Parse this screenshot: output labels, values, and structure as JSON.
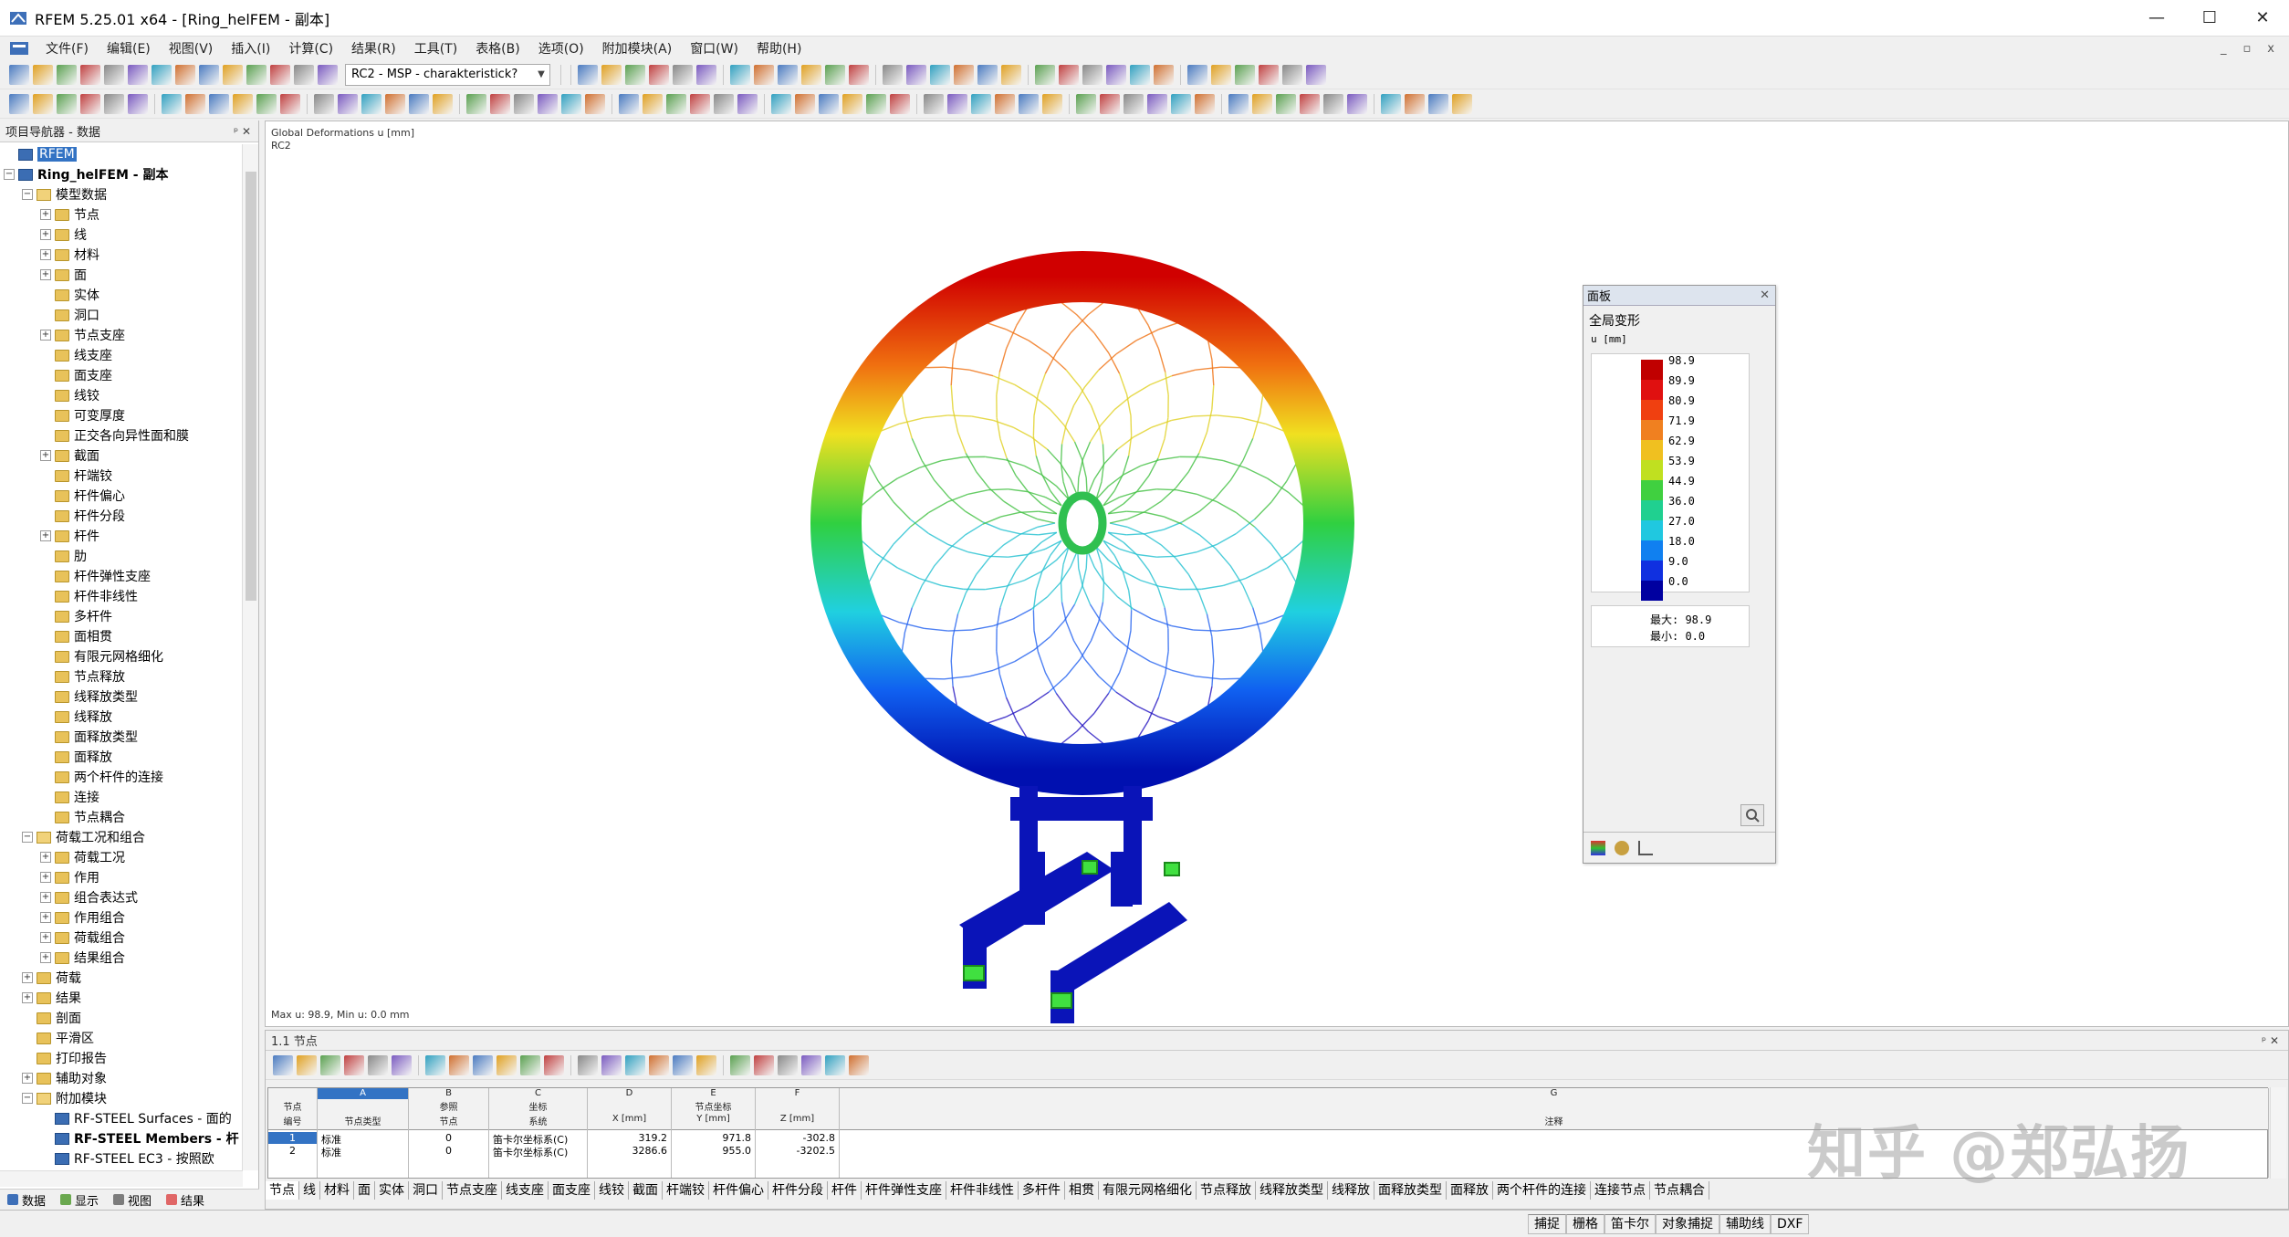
{
  "window": {
    "title": "RFEM 5.25.01 x64 - [Ring_helFEM - 副本]",
    "min": "—",
    "max": "☐",
    "close": "✕"
  },
  "menu": [
    "文件(F)",
    "编辑(E)",
    "视图(V)",
    "插入(I)",
    "计算(C)",
    "结果(R)",
    "工具(T)",
    "表格(B)",
    "选项(O)",
    "附加模块(A)",
    "窗口(W)",
    "帮助(H)"
  ],
  "mdi": {
    "min": "_",
    "restore": "▫",
    "close": "x"
  },
  "toolbar": {
    "combo_value": "RC2 - MSP - charakteristick?"
  },
  "navigator": {
    "title": "项目导航器 - 数据",
    "pin": "ᵖ ✕",
    "tree": [
      {
        "label": "RFEM",
        "level": 0,
        "exp": "",
        "icon": "app",
        "selected": true
      },
      {
        "label": "Ring_helFEM - 副本",
        "level": 0,
        "exp": "−",
        "icon": "doc",
        "bold": true
      },
      {
        "label": "模型数据",
        "level": 1,
        "exp": "−",
        "icon": "open"
      },
      {
        "label": "节点",
        "level": 2,
        "exp": "+",
        "icon": "folder"
      },
      {
        "label": "线",
        "level": 2,
        "exp": "+",
        "icon": "folder"
      },
      {
        "label": "材料",
        "level": 2,
        "exp": "+",
        "icon": "folder"
      },
      {
        "label": "面",
        "level": 2,
        "exp": "+",
        "icon": "folder"
      },
      {
        "label": "实体",
        "level": 2,
        "exp": "",
        "icon": "folder"
      },
      {
        "label": "洞口",
        "level": 2,
        "exp": "",
        "icon": "folder"
      },
      {
        "label": "节点支座",
        "level": 2,
        "exp": "+",
        "icon": "folder"
      },
      {
        "label": "线支座",
        "level": 2,
        "exp": "",
        "icon": "folder"
      },
      {
        "label": "面支座",
        "level": 2,
        "exp": "",
        "icon": "folder"
      },
      {
        "label": "线铰",
        "level": 2,
        "exp": "",
        "icon": "folder"
      },
      {
        "label": "可变厚度",
        "level": 2,
        "exp": "",
        "icon": "folder"
      },
      {
        "label": "正交各向异性面和膜",
        "level": 2,
        "exp": "",
        "icon": "folder"
      },
      {
        "label": "截面",
        "level": 2,
        "exp": "+",
        "icon": "folder"
      },
      {
        "label": "杆端铰",
        "level": 2,
        "exp": "",
        "icon": "folder"
      },
      {
        "label": "杆件偏心",
        "level": 2,
        "exp": "",
        "icon": "folder"
      },
      {
        "label": "杆件分段",
        "level": 2,
        "exp": "",
        "icon": "folder"
      },
      {
        "label": "杆件",
        "level": 2,
        "exp": "+",
        "icon": "folder"
      },
      {
        "label": "肋",
        "level": 2,
        "exp": "",
        "icon": "folder"
      },
      {
        "label": "杆件弹性支座",
        "level": 2,
        "exp": "",
        "icon": "folder"
      },
      {
        "label": "杆件非线性",
        "level": 2,
        "exp": "",
        "icon": "folder"
      },
      {
        "label": "多杆件",
        "level": 2,
        "exp": "",
        "icon": "folder"
      },
      {
        "label": "面相贯",
        "level": 2,
        "exp": "",
        "icon": "folder"
      },
      {
        "label": "有限元网格细化",
        "level": 2,
        "exp": "",
        "icon": "folder"
      },
      {
        "label": "节点释放",
        "level": 2,
        "exp": "",
        "icon": "folder"
      },
      {
        "label": "线释放类型",
        "level": 2,
        "exp": "",
        "icon": "folder"
      },
      {
        "label": "线释放",
        "level": 2,
        "exp": "",
        "icon": "folder"
      },
      {
        "label": "面释放类型",
        "level": 2,
        "exp": "",
        "icon": "folder"
      },
      {
        "label": "面释放",
        "level": 2,
        "exp": "",
        "icon": "folder"
      },
      {
        "label": "两个杆件的连接",
        "level": 2,
        "exp": "",
        "icon": "folder"
      },
      {
        "label": "连接",
        "level": 2,
        "exp": "",
        "icon": "folder"
      },
      {
        "label": "节点耦合",
        "level": 2,
        "exp": "",
        "icon": "folder"
      },
      {
        "label": "荷载工况和组合",
        "level": 1,
        "exp": "−",
        "icon": "open"
      },
      {
        "label": "荷载工况",
        "level": 2,
        "exp": "+",
        "icon": "folder"
      },
      {
        "label": "作用",
        "level": 2,
        "exp": "+",
        "icon": "folder"
      },
      {
        "label": "组合表达式",
        "level": 2,
        "exp": "+",
        "icon": "folder"
      },
      {
        "label": "作用组合",
        "level": 2,
        "exp": "+",
        "icon": "folder"
      },
      {
        "label": "荷载组合",
        "level": 2,
        "exp": "+",
        "icon": "folder"
      },
      {
        "label": "结果组合",
        "level": 2,
        "exp": "+",
        "icon": "folder"
      },
      {
        "label": "荷载",
        "level": 1,
        "exp": "+",
        "icon": "folder"
      },
      {
        "label": "结果",
        "level": 1,
        "exp": "+",
        "icon": "folder"
      },
      {
        "label": "剖面",
        "level": 1,
        "exp": "",
        "icon": "folder"
      },
      {
        "label": "平滑区",
        "level": 1,
        "exp": "",
        "icon": "folder"
      },
      {
        "label": "打印报告",
        "level": 1,
        "exp": "",
        "icon": "folder"
      },
      {
        "label": "辅助对象",
        "level": 1,
        "exp": "+",
        "icon": "folder"
      },
      {
        "label": "附加模块",
        "level": 1,
        "exp": "−",
        "icon": "open"
      },
      {
        "label": "RF-STEEL Surfaces - 面的",
        "level": 2,
        "exp": "",
        "icon": "doc"
      },
      {
        "label": "RF-STEEL Members - 杆",
        "level": 2,
        "exp": "",
        "icon": "doc",
        "bold": true
      },
      {
        "label": "RF-STEEL EC3 - 按照欧",
        "level": 2,
        "exp": "",
        "icon": "doc"
      }
    ],
    "tabs": [
      "数据",
      "显示",
      "视图",
      "结果"
    ]
  },
  "viewport": {
    "label1": "Global Deformations u [mm]",
    "label2": "RC2",
    "footer": "Max u: 98.9, Min u: 0.0 mm"
  },
  "panel": {
    "head": "面板",
    "close": "✕",
    "title": "全局变形",
    "unit": "u [mm]",
    "legend": [
      {
        "value": "98.9",
        "color": "#c00000"
      },
      {
        "value": "89.9",
        "color": "#e01010"
      },
      {
        "value": "80.9",
        "color": "#f04010"
      },
      {
        "value": "71.9",
        "color": "#f08020"
      },
      {
        "value": "62.9",
        "color": "#f0c020"
      },
      {
        "value": "53.9",
        "color": "#c0e020"
      },
      {
        "value": "44.9",
        "color": "#40d040"
      },
      {
        "value": "36.0",
        "color": "#20d090"
      },
      {
        "value": "27.0",
        "color": "#20c8e0"
      },
      {
        "value": "18.0",
        "color": "#1080f0"
      },
      {
        "value": "9.0",
        "color": "#1030e0"
      },
      {
        "value": "0.0",
        "color": "#0000a0"
      }
    ],
    "max": "最大: 98.9",
    "min": "最小:  0.0"
  },
  "table": {
    "title": "1.1 节点",
    "pin": "ᵖ ✕",
    "columns": [
      {
        "letter": "",
        "h1": "节点",
        "h2": "编号"
      },
      {
        "letter": "A",
        "h1": "",
        "h2": "节点类型"
      },
      {
        "letter": "B",
        "h1": "参照",
        "h2": "节点"
      },
      {
        "letter": "C",
        "h1": "坐标",
        "h2": "系统"
      },
      {
        "letter": "D",
        "h1": "",
        "h2": "X [mm]"
      },
      {
        "letter": "E",
        "h1": "节点坐标",
        "h2": "Y [mm]"
      },
      {
        "letter": "F",
        "h1": "",
        "h2": "Z [mm]"
      },
      {
        "letter": "G",
        "h1": "",
        "h2": "注释"
      }
    ],
    "rows": [
      [
        "1",
        "标准",
        "0",
        "笛卡尔坐标系(C)",
        "319.2",
        "971.8",
        "-302.8",
        ""
      ],
      [
        "2",
        "标准",
        "0",
        "笛卡尔坐标系(C)",
        "3286.6",
        "955.0",
        "-3202.5",
        ""
      ]
    ],
    "tabs": [
      "节点",
      "线",
      "材料",
      "面",
      "实体",
      "洞口",
      "节点支座",
      "线支座",
      "面支座",
      "线铰",
      "截面",
      "杆端铰",
      "杆件偏心",
      "杆件分段",
      "杆件",
      "杆件弹性支座",
      "杆件非线性",
      "多杆件",
      "相贯",
      "有限元网格细化",
      "节点释放",
      "线释放类型",
      "线释放",
      "面释放类型",
      "面释放",
      "两个杆件的连接",
      "连接节点",
      "节点耦合"
    ]
  },
  "status": [
    "捕捉",
    "栅格",
    "笛卡尔",
    "对象捕捉",
    "辅助线",
    "DXF"
  ],
  "watermark": "知乎 @郑弘扬"
}
